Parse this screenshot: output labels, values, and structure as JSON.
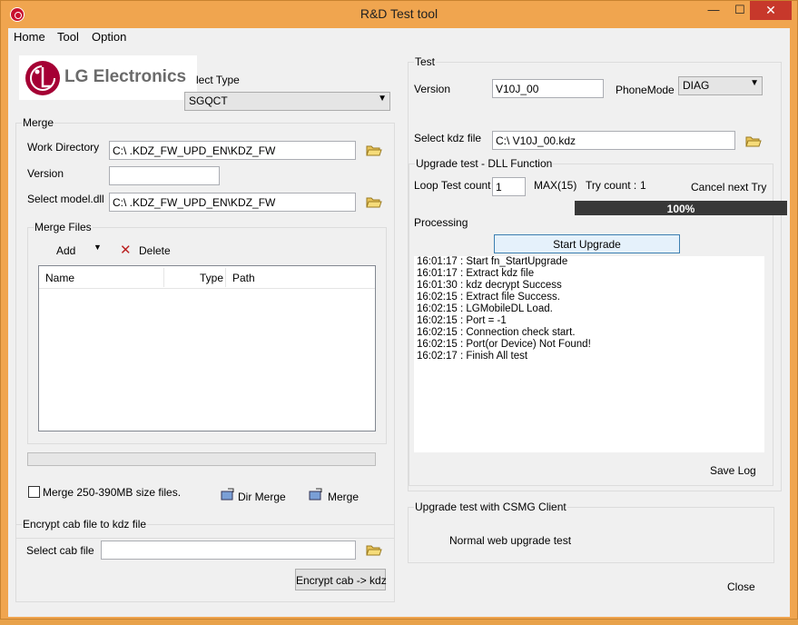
{
  "window": {
    "title": "R&D Test tool",
    "minimize": "—",
    "maximize": "☐",
    "close": "✕"
  },
  "menu": [
    "Home",
    "Tool",
    "Option"
  ],
  "logo_text": "LG Electronics",
  "select_type": {
    "label": "lect Type",
    "value": "SGQCT"
  },
  "merge": {
    "group_label": "Merge",
    "work_dir_label": "Work Directory",
    "work_dir_value": "C:\\                                        .KDZ_FW_UPD_EN\\KDZ_FW",
    "version_label": "Version",
    "version_value": "",
    "model_label": "Select model.dll",
    "model_value": "C:\\                                        .KDZ_FW_UPD_EN\\KDZ_FW",
    "files_group_label": "Merge Files",
    "add_label": "Add",
    "delete_label": "Delete",
    "columns": [
      "Name",
      "Type",
      "Path"
    ],
    "checkbox_label": "Merge 250-390MB size files.",
    "dir_merge_label": "Dir Merge",
    "merge_label": "Merge"
  },
  "encrypt": {
    "group_label": "Encrypt cab file to kdz file",
    "select_label": "Select cab file",
    "select_value": "",
    "button_label": "Encrypt cab -> kdz"
  },
  "test": {
    "group_label": "Test",
    "version_label": "Version",
    "version_value": "V10J_00",
    "phonemode_label": "PhoneMode",
    "phonemode_value": "DIAG",
    "kdz_label": "Select kdz file",
    "kdz_value": "C:\\                                   V10J_00.kdz",
    "upgrade_group_label": "Upgrade test - DLL Function",
    "loop_label": "Loop Test count",
    "loop_value": "1",
    "max_label": "MAX(15)",
    "try_label": "Try count :",
    "try_value": "1",
    "cancel_label": "Cancel next Try",
    "progress_text": "100%",
    "progress_fraction": 1.0,
    "processing_label": "Processing",
    "start_label": "Start Upgrade",
    "log": [
      "16:01:17 : Start fn_StartUpgrade",
      "16:01:17 : Extract kdz file",
      "16:01:30 : kdz decrypt Success",
      "16:02:15 : Extract file Success.",
      "16:02:15 : LGMobileDL Load.",
      "16:02:15 : Port = -1",
      "16:02:15 : Connection check start.",
      "16:02:15 : Port(or Device) Not Found!",
      "16:02:17 : Finish All test"
    ],
    "save_log_label": "Save Log",
    "csmg_group_label": "Upgrade test with CSMG Client",
    "normal_web_label": "Normal web upgrade test",
    "close_label": "Close"
  },
  "colors": {
    "titlebar": "#f0a54f",
    "close_button": "#c7382b",
    "progress_fill": "#383838",
    "lg_red": "#a50034"
  }
}
